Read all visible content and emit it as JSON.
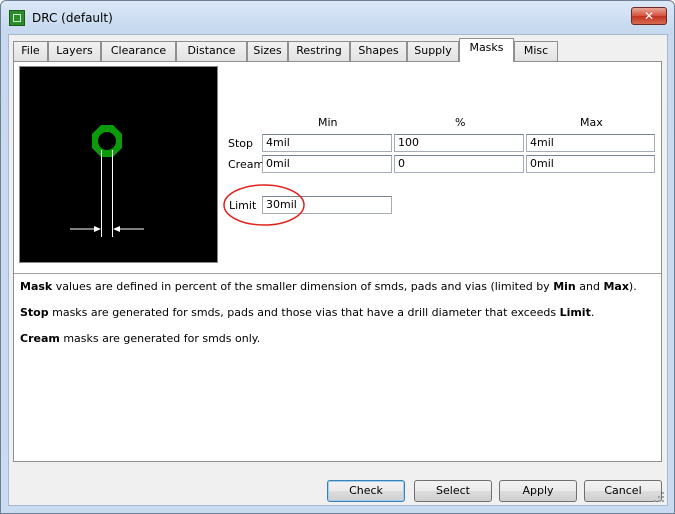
{
  "window": {
    "title": "DRC (default)",
    "close_glyph": "✕"
  },
  "tabs": [
    {
      "label": "File"
    },
    {
      "label": "Layers"
    },
    {
      "label": "Clearance"
    },
    {
      "label": "Distance"
    },
    {
      "label": "Sizes"
    },
    {
      "label": "Restring"
    },
    {
      "label": "Shapes"
    },
    {
      "label": "Supply"
    },
    {
      "label": "Masks",
      "active": true
    },
    {
      "label": "Misc"
    }
  ],
  "masks": {
    "headers": {
      "min": "Min",
      "percent": "%",
      "max": "Max"
    },
    "rows": {
      "stop": {
        "label": "Stop",
        "min": "4mil",
        "percent": "100",
        "max": "4mil"
      },
      "cream": {
        "label": "Cream",
        "min": "0mil",
        "percent": "0",
        "max": "0mil"
      }
    },
    "limit": {
      "label": "Limit",
      "value": "30mil"
    }
  },
  "description": {
    "line1": {
      "b1": "Mask",
      "t1": " values are defined in percent of the smaller dimension of smds, pads and vias (limited by ",
      "b2": "Min",
      "t2": " and ",
      "b3": "Max",
      "t3": ")."
    },
    "line2": {
      "b1": "Stop",
      "t1": " masks are generated for smds, pads and those vias that have a drill diameter that exceeds ",
      "b2": "Limit",
      "t2": "."
    },
    "line3": {
      "b1": "Cream",
      "t1": " masks are generated for smds only."
    }
  },
  "buttons": {
    "check": "Check",
    "select": "Select",
    "apply": "Apply",
    "cancel": "Cancel"
  },
  "colors": {
    "pad": "#0a9a0a",
    "annotation": "#e0201a",
    "preview_bg": "#000000"
  }
}
